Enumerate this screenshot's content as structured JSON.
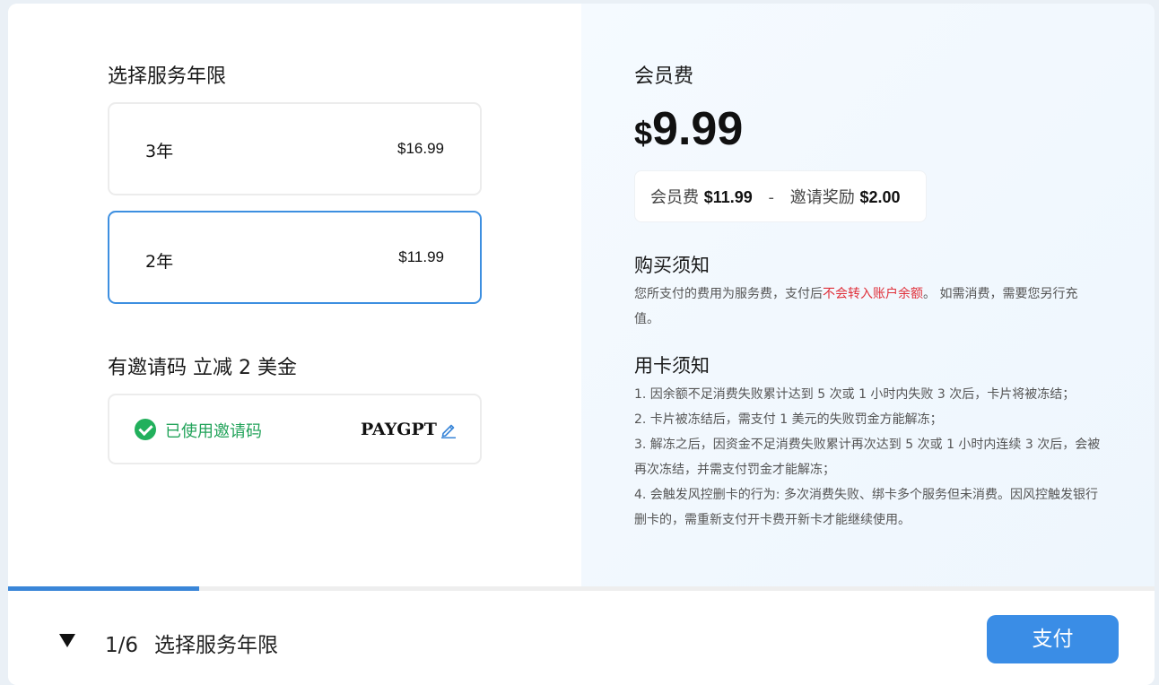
{
  "left": {
    "service_title": "选择服务年限",
    "options": [
      {
        "years": "3年",
        "price": "$16.99",
        "selected": false
      },
      {
        "years": "2年",
        "price": "$11.99",
        "selected": true
      }
    ],
    "invite_title": "有邀请码 立减 2 美金",
    "invite": {
      "status": "已使用邀请码",
      "code": "PAYGPT",
      "edit_icon": "pencil-edit-icon",
      "status_icon": "check-circle-icon"
    }
  },
  "right": {
    "fee_label": "会员费",
    "currency": "$",
    "amount": "9.99",
    "breakdown": {
      "fee_label": "会员费",
      "fee_value": "$11.99",
      "separator": "-",
      "reward_label": "邀请奖励",
      "reward_value": "$2.00"
    },
    "purchase_notice": {
      "title": "购买须知",
      "text_before": "您所支付的费用为服务费，支付后",
      "highlight": "不会转入账户余额",
      "text_after": "。 如需消费，需要您另行充值。"
    },
    "card_notice": {
      "title": "用卡须知",
      "items": [
        "1. 因余额不足消费失败累计达到 5 次或 1 小时内失败 3 次后，卡片将被冻结；",
        "2. 卡片被冻结后，需支付 1 美元的失败罚金方能解冻；",
        "3. 解冻之后，因资金不足消费失败累计再次达到 5 次或 1 小时内连续 3 次后，会被再次冻结，并需支付罚金才能解冻；",
        "4. 会触发风控删卡的行为: 多次消费失败、绑卡多个服务但未消费。因风控触发银行删卡的，需重新支付开卡费开新卡才能继续使用。"
      ]
    }
  },
  "footer": {
    "step_count": "1/6",
    "step_label": "选择服务年限",
    "progress_fraction": 0.1667,
    "pay_label": "支付",
    "toggle_icon": "triangle-down-icon"
  },
  "colors": {
    "accent": "#3a8de6",
    "success": "#22b05c",
    "warning_text": "#e0303a"
  }
}
